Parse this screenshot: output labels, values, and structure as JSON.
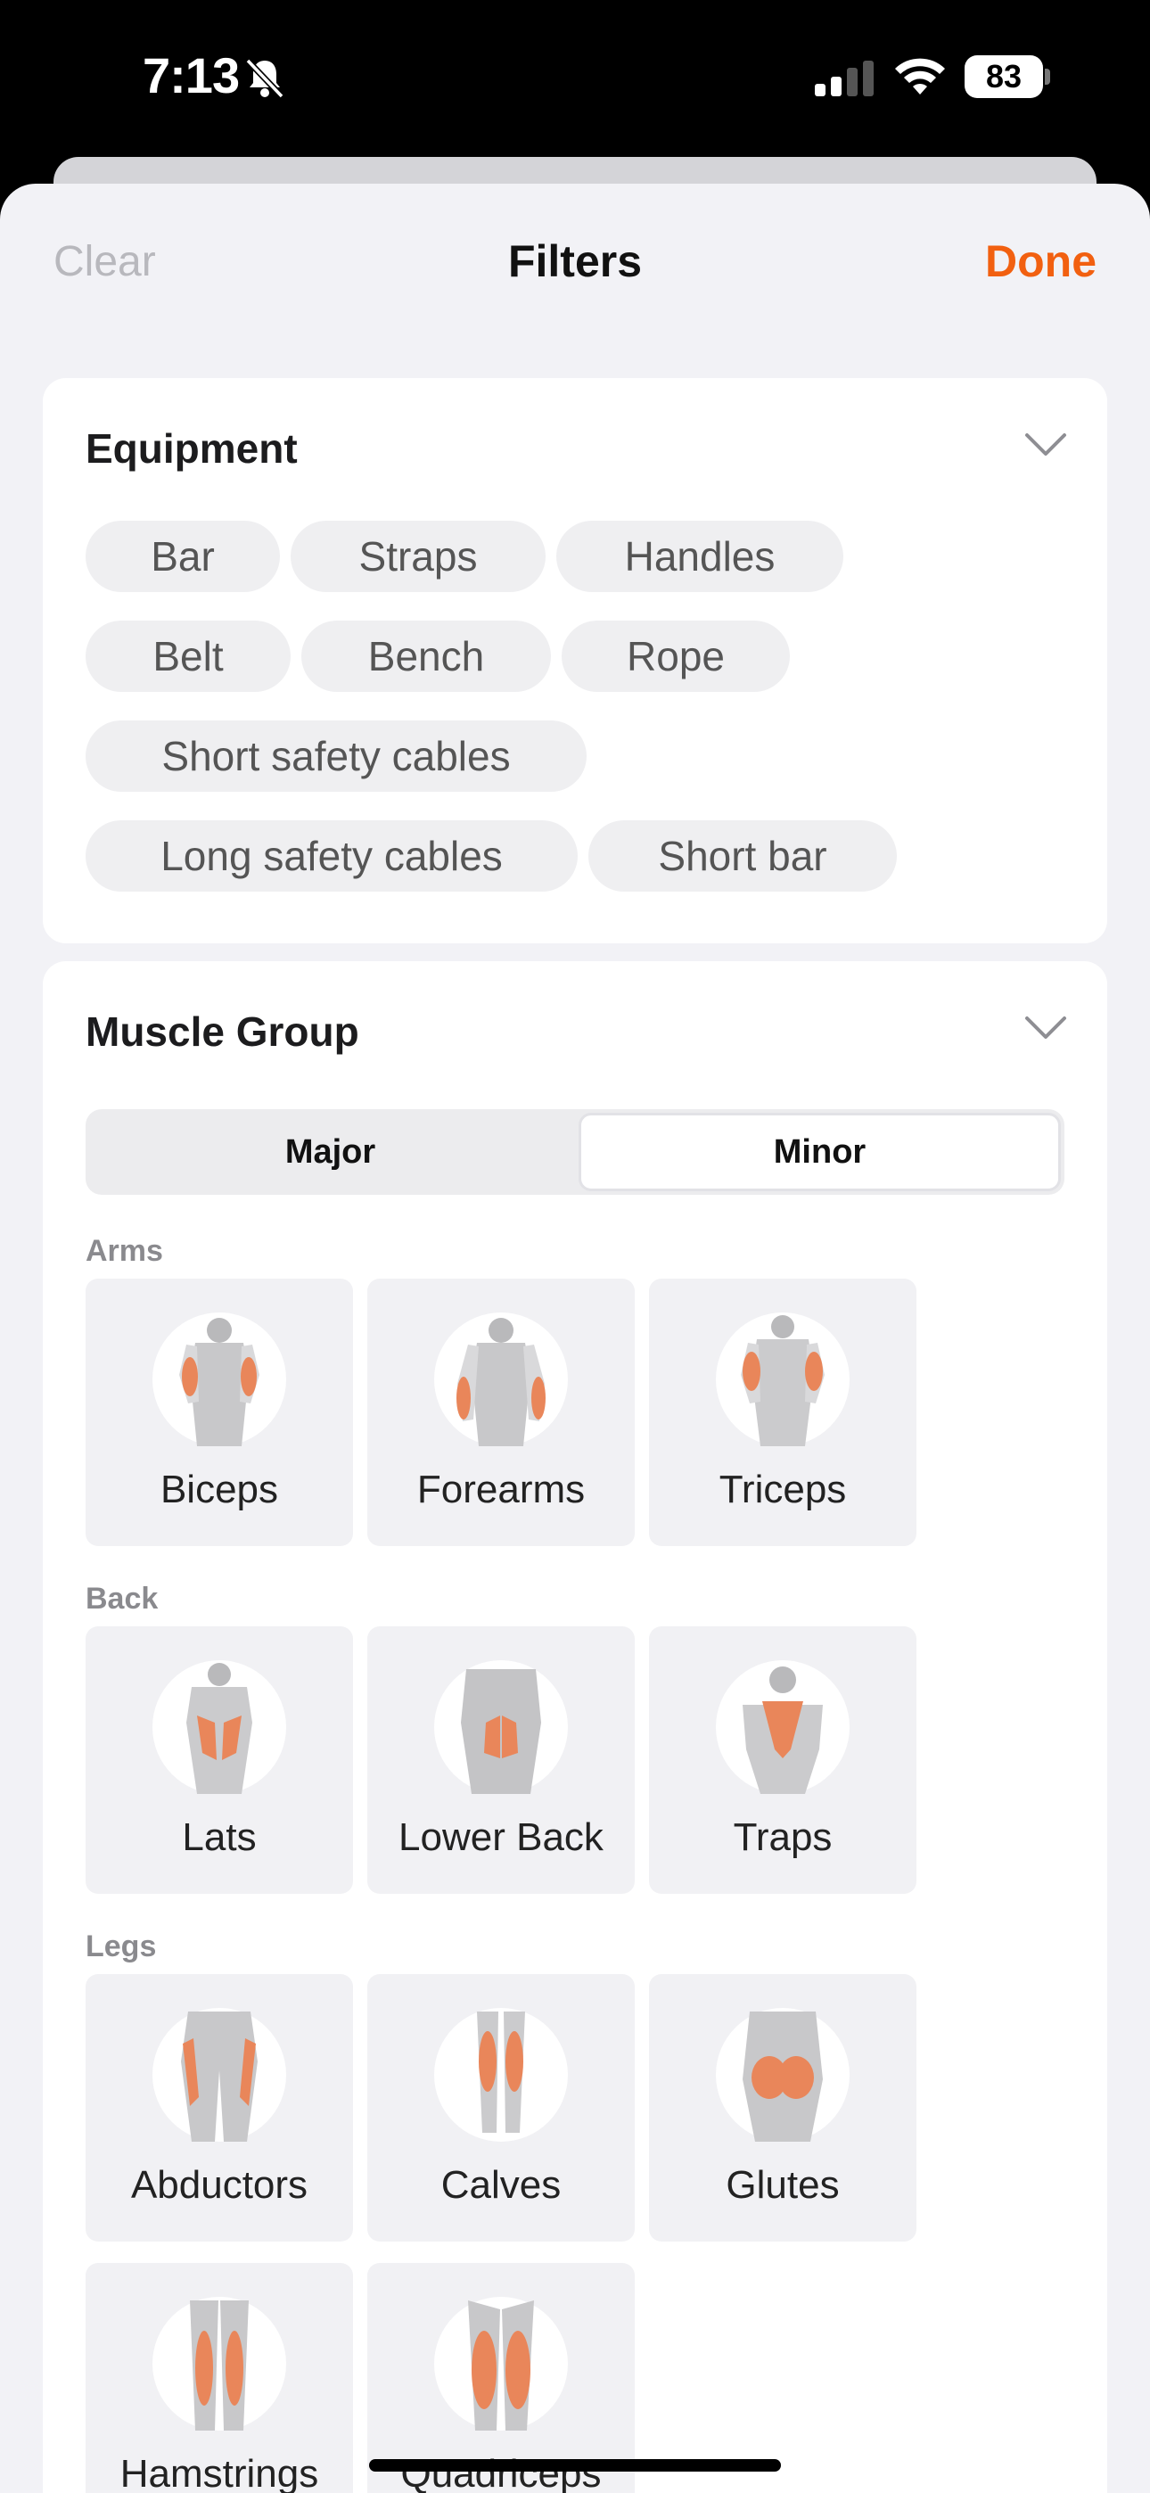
{
  "status_bar": {
    "time": "7:13",
    "battery": "83"
  },
  "nav": {
    "clear": "Clear",
    "title": "Filters",
    "done": "Done"
  },
  "equipment": {
    "title": "Equipment",
    "chips": [
      "Bar",
      "Straps",
      "Handles",
      "Belt",
      "Bench",
      "Rope",
      "Short safety cables",
      "Long safety cables",
      "Short bar"
    ]
  },
  "muscle_group": {
    "title": "Muscle Group",
    "segments": [
      "Major",
      "Minor"
    ],
    "selected_segment": "Minor",
    "sections": [
      {
        "label": "Arms",
        "items": [
          "Biceps",
          "Forearms",
          "Triceps"
        ]
      },
      {
        "label": "Back",
        "items": [
          "Lats",
          "Lower Back",
          "Traps"
        ]
      },
      {
        "label": "Legs",
        "items": [
          "Abductors",
          "Calves",
          "Glutes",
          "Hamstrings",
          "Quadriceps"
        ]
      }
    ]
  },
  "colors": {
    "accent": "#f26010",
    "muscle_highlight": "#e9865a"
  }
}
